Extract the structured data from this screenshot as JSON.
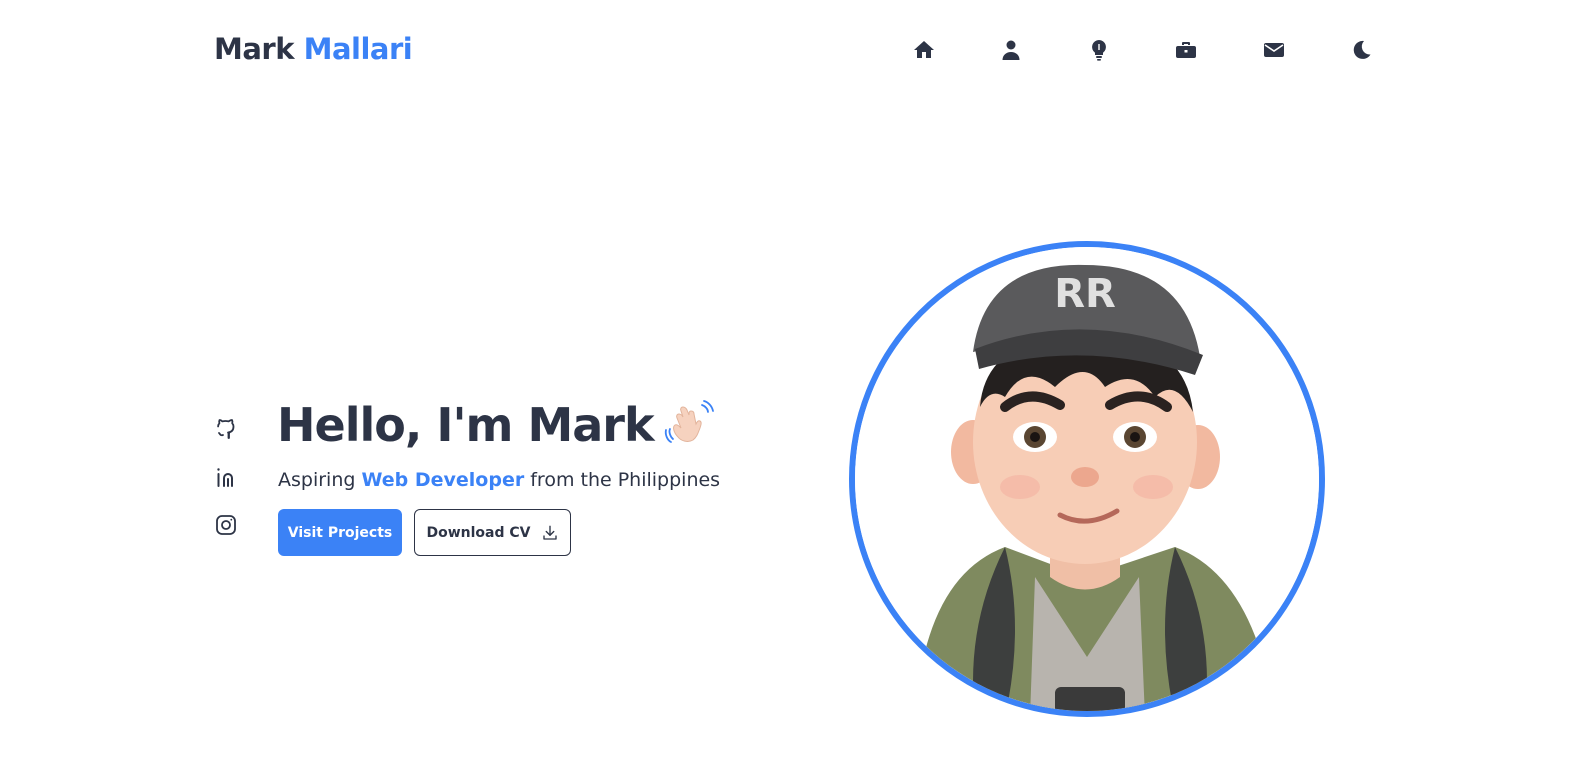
{
  "header": {
    "logo_first": "Mark",
    "logo_second": "Mallari",
    "nav": [
      {
        "icon": "home-icon"
      },
      {
        "icon": "user-icon"
      },
      {
        "icon": "lightbulb-icon"
      },
      {
        "icon": "briefcase-icon"
      },
      {
        "icon": "envelope-icon"
      },
      {
        "icon": "moon-icon"
      }
    ]
  },
  "socials": [
    {
      "icon": "github-icon"
    },
    {
      "icon": "linkedin-icon"
    },
    {
      "icon": "instagram-icon"
    }
  ],
  "hero": {
    "greeting": "Hello, I'm Mark",
    "subtitle_prefix": "Aspiring ",
    "subtitle_highlight": "Web Developer",
    "subtitle_suffix": " from the Philippines",
    "visit_label": "Visit Projects",
    "download_label": "Download CV",
    "cap_logo_text": "RR"
  },
  "colors": {
    "accent": "#3b82f6",
    "text": "#2d3446"
  }
}
